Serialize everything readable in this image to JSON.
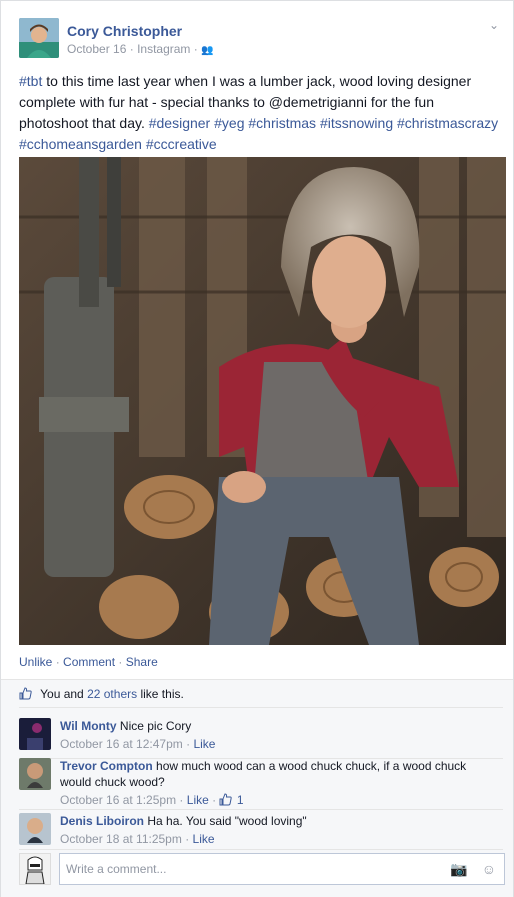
{
  "post": {
    "author": "Cory Christopher",
    "date": "October 16",
    "source": "Instagram",
    "text_parts": [
      {
        "t": "#tbt",
        "tag": true
      },
      {
        "t": " to this time last year when I was a lumber jack, wood loving designer complete with fur hat - special thanks to @demetrigianni for the fun photoshoot that day. ",
        "tag": false
      },
      {
        "t": "#designer",
        "tag": true
      },
      {
        "t": " ",
        "tag": false
      },
      {
        "t": "#yeg",
        "tag": true
      },
      {
        "t": " ",
        "tag": false
      },
      {
        "t": "#christmas",
        "tag": true
      },
      {
        "t": " ",
        "tag": false
      },
      {
        "t": "#itssnowing",
        "tag": true
      },
      {
        "t": " ",
        "tag": false
      },
      {
        "t": "#christmascrazy",
        "tag": true
      },
      {
        "t": " ",
        "tag": false
      },
      {
        "t": "#cchomeansgarden",
        "tag": true
      },
      {
        "t": " ",
        "tag": false
      },
      {
        "t": "#cccreative",
        "tag": true
      }
    ]
  },
  "actions": {
    "unlike": "Unlike",
    "comment": "Comment",
    "share": "Share"
  },
  "likes": {
    "you_and": "You and",
    "others": "22 others",
    "like_this": "like this."
  },
  "comments": [
    {
      "name": "Wil Monty",
      "text": "Nice pic Cory",
      "time": "October 16 at 12:47pm",
      "like": "Like",
      "likes": ""
    },
    {
      "name": "Trevor Compton",
      "text": "how much wood can a wood chuck chuck, if a wood chuck would chuck wood?",
      "time": "October 16 at 1:25pm",
      "like": "Like",
      "likes": "1"
    },
    {
      "name": "Denis Liboiron",
      "text": "Ha ha. You said \"wood loving\"",
      "time": "October 18 at 11:25pm",
      "like": "Like",
      "likes": ""
    }
  ],
  "composer": {
    "placeholder": "Write a comment..."
  },
  "colors": {
    "link": "#3b5998",
    "meta": "#9197a3",
    "background": "#f6f7f9"
  }
}
